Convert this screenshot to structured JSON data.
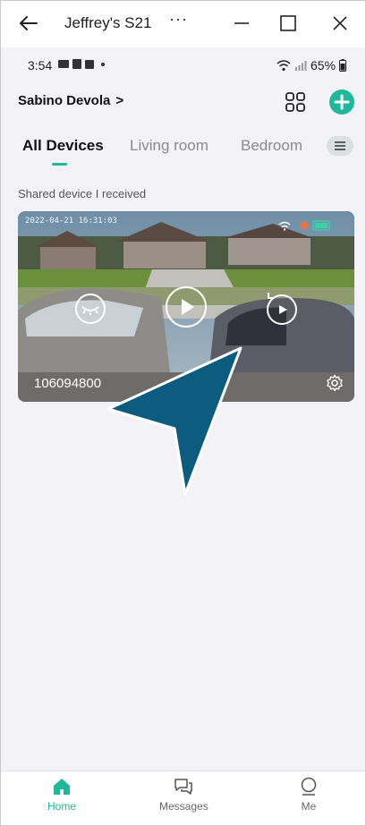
{
  "window": {
    "title": "Jeffrey's S21",
    "more_label": "···"
  },
  "status_bar": {
    "time": "3:54",
    "battery": "65%"
  },
  "header": {
    "account_name": "Sabino Devola",
    "chevron": ">"
  },
  "tabs": [
    {
      "label": "All Devices",
      "active": true
    },
    {
      "label": "Living room",
      "active": false
    },
    {
      "label": "Bedroom",
      "active": false
    }
  ],
  "section": {
    "label": "Shared device I received"
  },
  "device_card": {
    "name": "106094800",
    "timestamp": "2022-04-21 16:31:03"
  },
  "bottom_nav": [
    {
      "label": "Home",
      "icon": "home-icon",
      "active": true
    },
    {
      "label": "Messages",
      "icon": "messages-icon",
      "active": false
    },
    {
      "label": "Me",
      "icon": "person-icon",
      "active": false
    }
  ],
  "colors": {
    "accent": "#1fb89a",
    "pointer": "#0b5c7e"
  }
}
